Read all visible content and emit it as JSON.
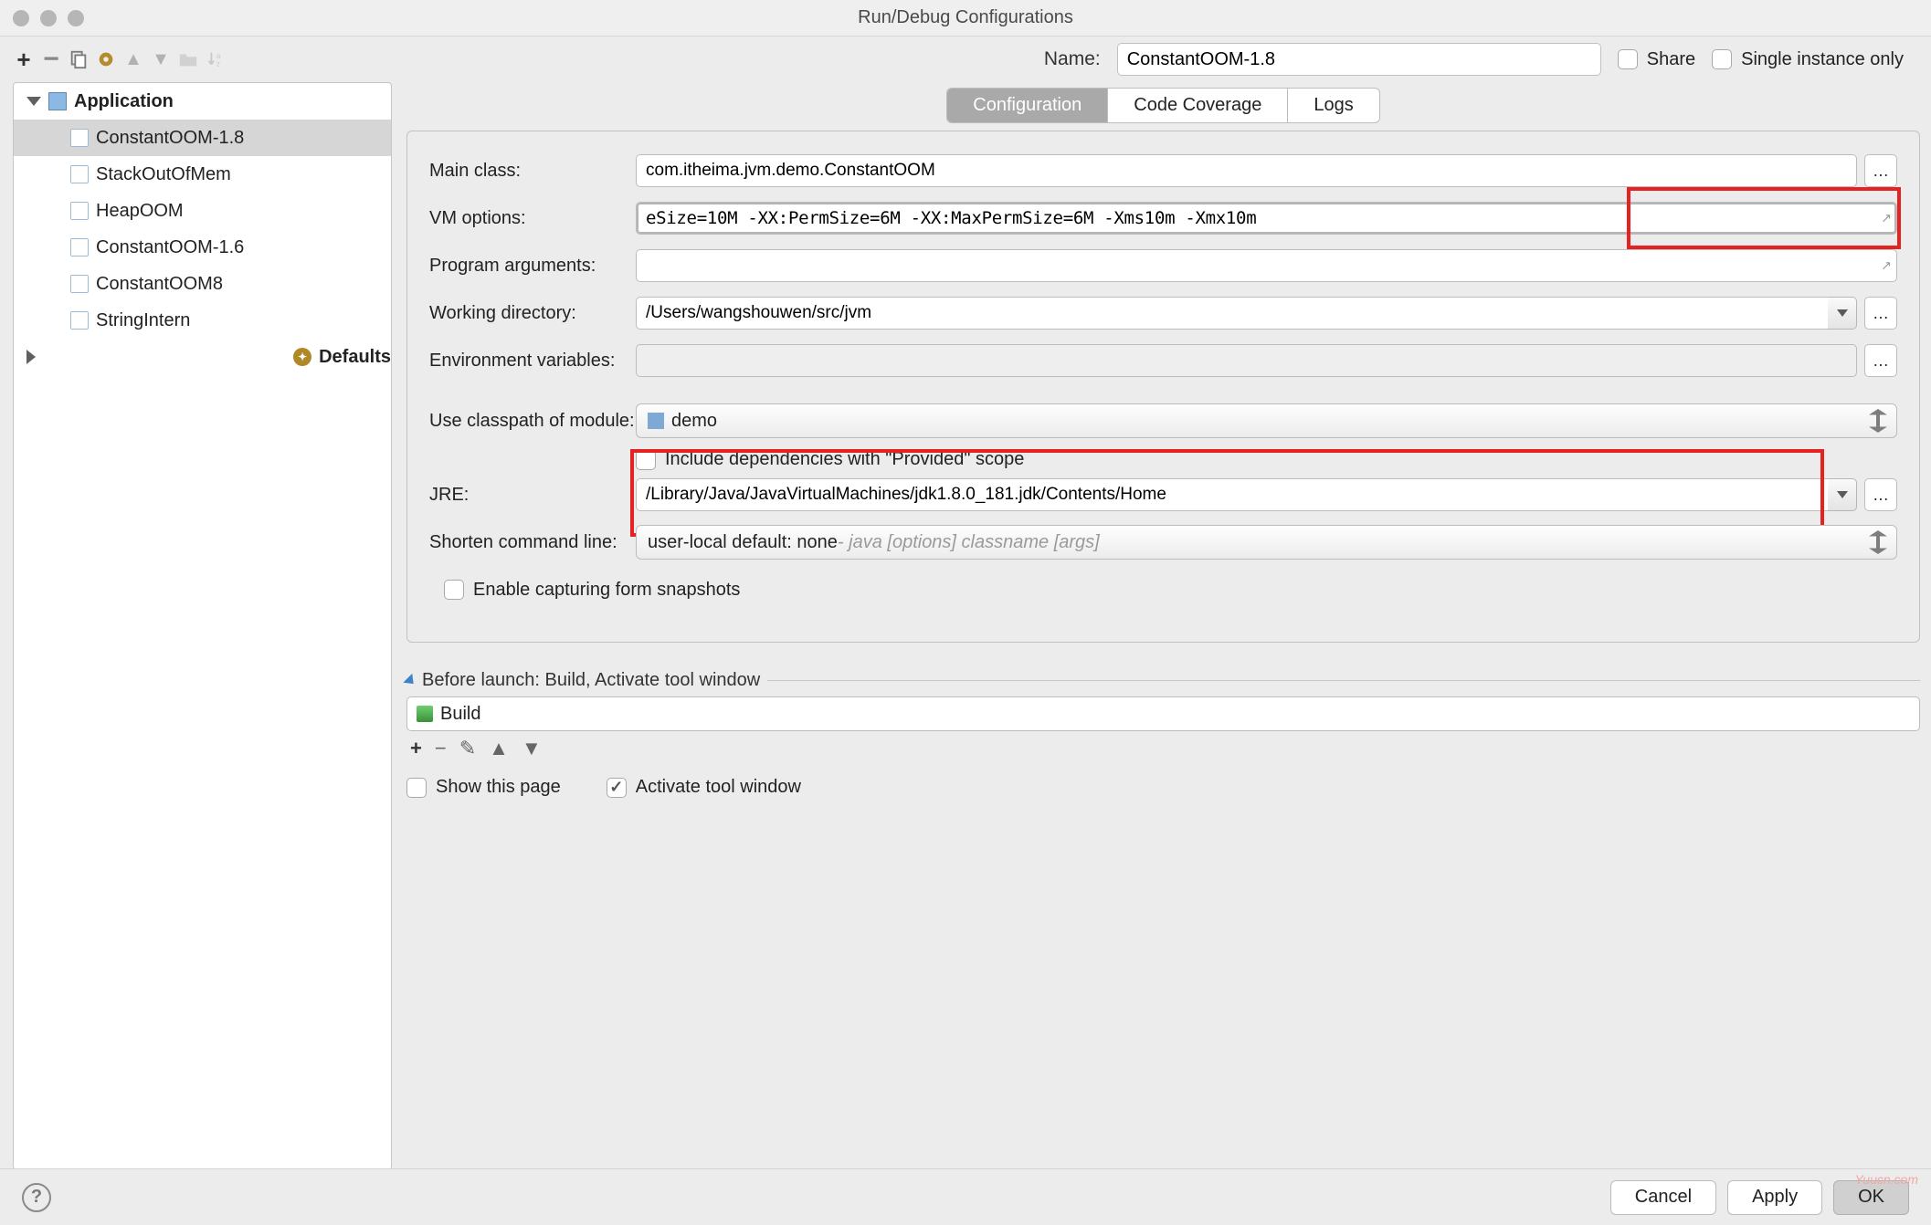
{
  "window": {
    "title": "Run/Debug Configurations"
  },
  "topbar": {
    "name_label": "Name:",
    "name_value": "ConstantOOM-1.8",
    "share_label": "Share",
    "single_instance_label": "Single instance only"
  },
  "tree": {
    "application_label": "Application",
    "defaults_label": "Defaults",
    "items": [
      {
        "label": "ConstantOOM-1.8"
      },
      {
        "label": "StackOutOfMem"
      },
      {
        "label": "HeapOOM"
      },
      {
        "label": "ConstantOOM-1.6"
      },
      {
        "label": "ConstantOOM8"
      },
      {
        "label": "StringIntern"
      }
    ]
  },
  "tabs": {
    "configuration": "Configuration",
    "code_coverage": "Code Coverage",
    "logs": "Logs"
  },
  "form": {
    "main_class_label": "Main class:",
    "main_class_value": "com.itheima.jvm.demo.ConstantOOM",
    "vm_options_label": "VM options:",
    "vm_options_value": "eSize=10M -XX:PermSize=6M -XX:MaxPermSize=6M -Xms10m -Xmx10m",
    "program_args_label": "Program arguments:",
    "program_args_value": "",
    "working_dir_label": "Working directory:",
    "working_dir_value": "/Users/wangshouwen/src/jvm",
    "env_vars_label": "Environment variables:",
    "env_vars_value": "",
    "classpath_label": "Use classpath of module:",
    "classpath_value": "demo",
    "include_provided_label": "Include dependencies with \"Provided\" scope",
    "jre_label": "JRE:",
    "jre_value": "/Library/Java/JavaVirtualMachines/jdk1.8.0_181.jdk/Contents/Home",
    "shorten_label": "Shorten command line:",
    "shorten_value": "user-local default: none",
    "shorten_hint": " - java [options] classname [args]",
    "snapshots_label": "Enable capturing form snapshots"
  },
  "before_launch": {
    "title": "Before launch: Build, Activate tool window",
    "build_label": "Build"
  },
  "bottom_checks": {
    "show_page": "Show this page",
    "activate_tool": "Activate tool window"
  },
  "footer": {
    "cancel": "Cancel",
    "apply": "Apply",
    "ok": "OK"
  },
  "watermark": "Yuucn.com"
}
